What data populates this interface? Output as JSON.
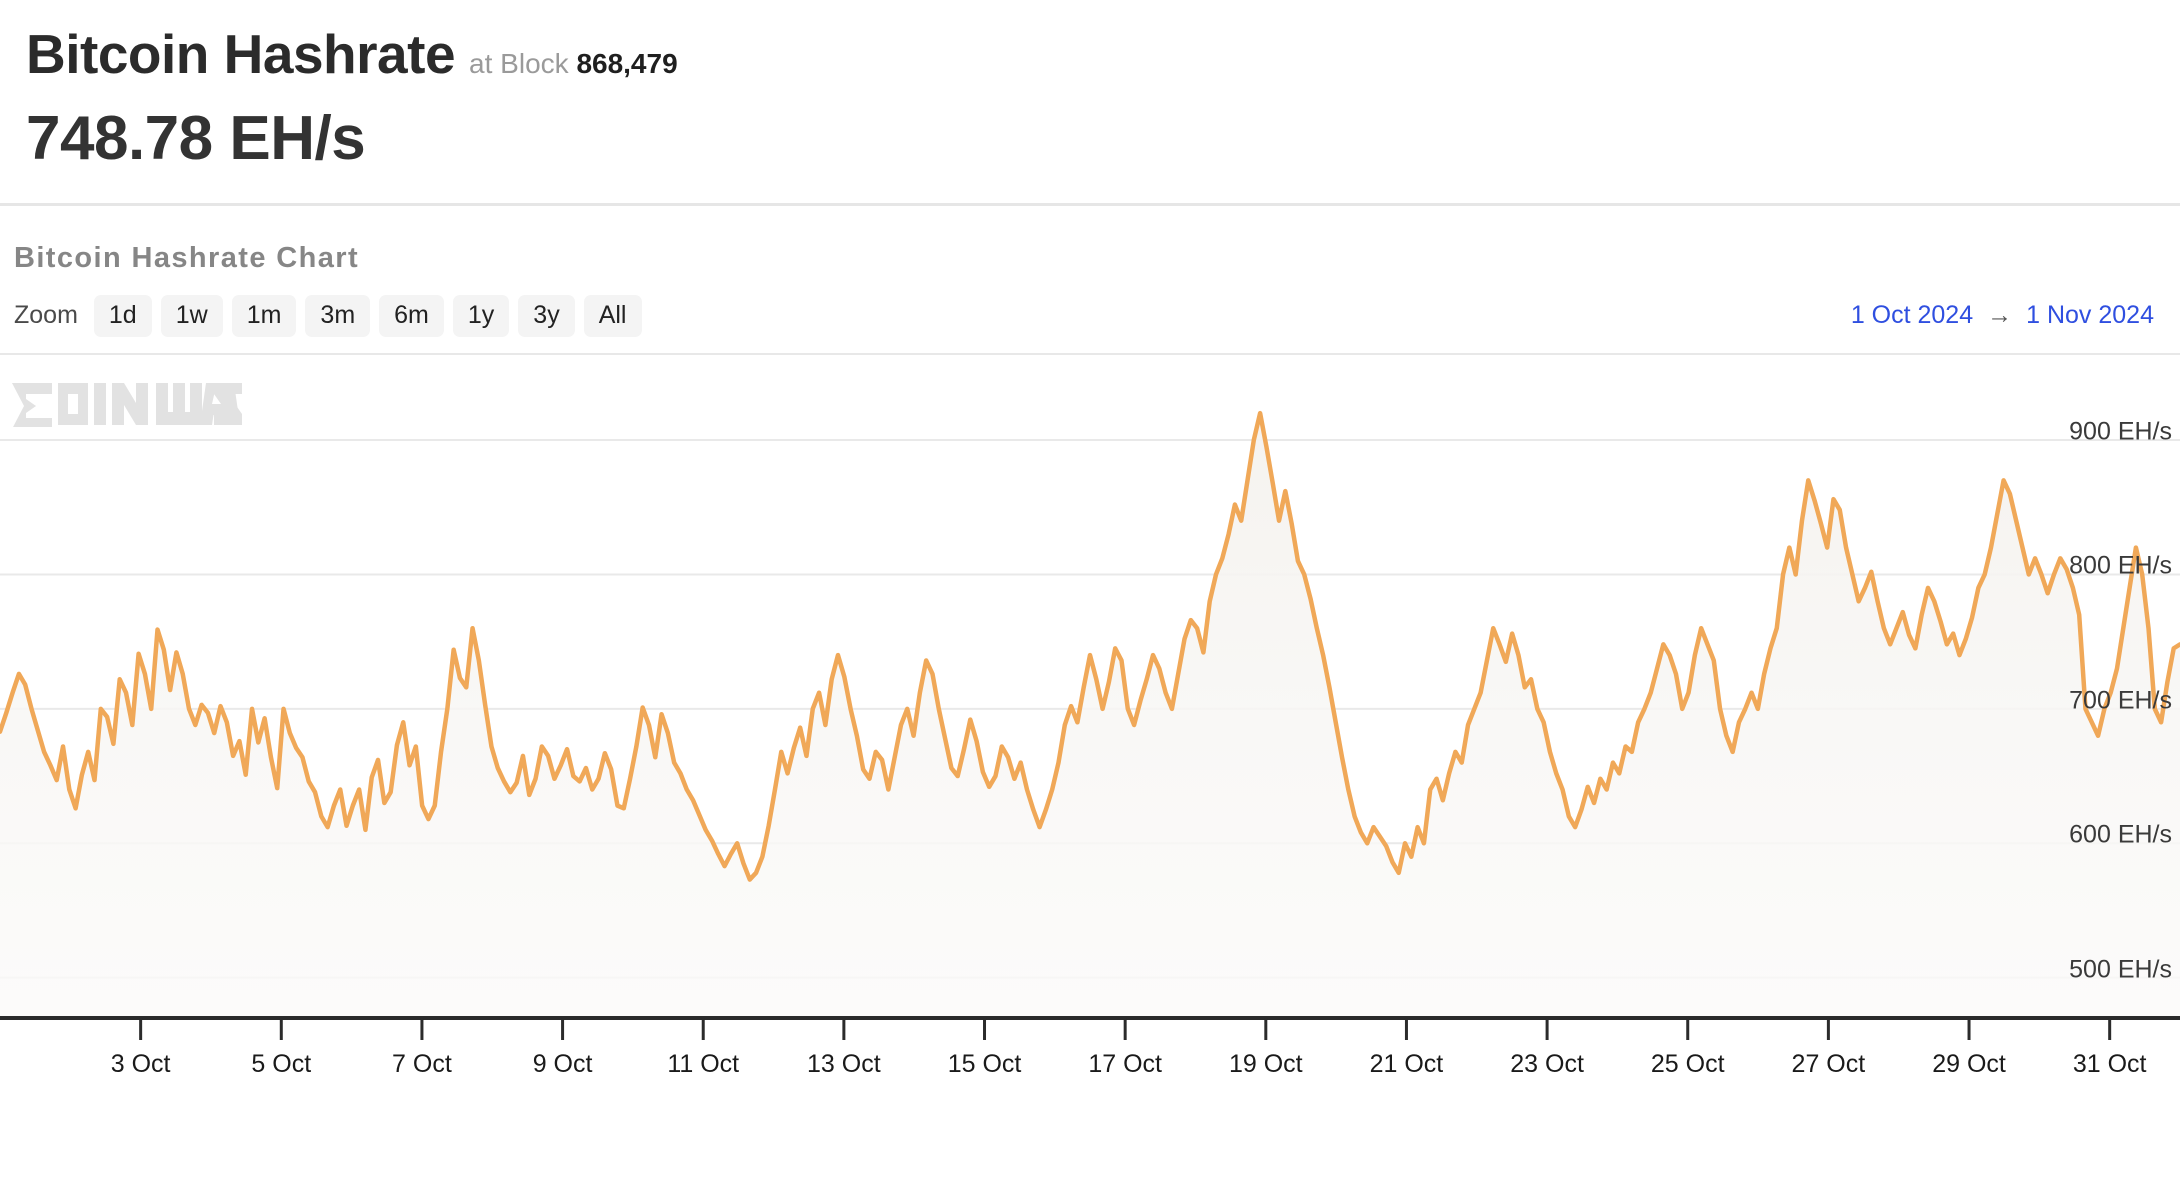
{
  "header": {
    "title": "Bitcoin Hashrate",
    "at_block_prefix": "at Block",
    "block_number": "868,479",
    "current_value": "748.78 EH/s"
  },
  "chart_section": {
    "title": "Bitcoin Hashrate Chart",
    "zoom_label": "Zoom",
    "zoom_buttons": [
      "1d",
      "1w",
      "1m",
      "3m",
      "6m",
      "1y",
      "3y",
      "All"
    ],
    "range_start": "1 Oct 2024",
    "range_arrow": "→",
    "range_end": "1 Nov 2024",
    "watermark": "CoinWarz",
    "accent_color": "#f0a858",
    "link_color": "#2f4fe0",
    "button_bg": "#f4f4f4"
  },
  "chart_data": {
    "type": "area",
    "title": "Bitcoin Hashrate Chart",
    "xlabel": "",
    "ylabel": "EH/s",
    "ylim": [
      470,
      935
    ],
    "yticks": [
      500,
      600,
      700,
      800,
      900
    ],
    "ytick_labels": [
      "500 EH/s",
      "600 EH/s",
      "700 EH/s",
      "800 EH/s",
      "900 EH/s"
    ],
    "xticks": [
      "3 Oct",
      "5 Oct",
      "7 Oct",
      "9 Oct",
      "11 Oct",
      "13 Oct",
      "15 Oct",
      "17 Oct",
      "19 Oct",
      "21 Oct",
      "23 Oct",
      "25 Oct",
      "27 Oct",
      "29 Oct",
      "31 Oct"
    ],
    "x_start": "1 Oct 2024",
    "x_end": "1 Nov 2024",
    "grid": "horizontal",
    "legend": "none",
    "series_name": "Bitcoin Hashrate",
    "line_color": "#f0a858",
    "fill_color": "#f7f5f2",
    "values": [
      683,
      697,
      712,
      726,
      718,
      700,
      684,
      668,
      658,
      647,
      672,
      640,
      626,
      651,
      668,
      647,
      700,
      694,
      674,
      722,
      712,
      688,
      741,
      726,
      700,
      759,
      744,
      714,
      742,
      726,
      700,
      688,
      703,
      697,
      682,
      702,
      690,
      665,
      676,
      651,
      700,
      675,
      693,
      664,
      641,
      700,
      682,
      671,
      664,
      646,
      638,
      620,
      612,
      628,
      640,
      613,
      628,
      640,
      610,
      649,
      662,
      630,
      638,
      673,
      690,
      658,
      672,
      628,
      618,
      628,
      668,
      700,
      744,
      723,
      716,
      760,
      736,
      703,
      672,
      656,
      646,
      638,
      645,
      665,
      636,
      648,
      672,
      665,
      648,
      658,
      670,
      650,
      646,
      656,
      640,
      648,
      667,
      655,
      628,
      626,
      648,
      672,
      701,
      688,
      664,
      696,
      682,
      660,
      652,
      640,
      632,
      621,
      610,
      602,
      592,
      583,
      592,
      600,
      585,
      573,
      578,
      590,
      613,
      640,
      668,
      652,
      671,
      686,
      665,
      700,
      712,
      688,
      722,
      740,
      724,
      700,
      680,
      655,
      648,
      668,
      662,
      640,
      664,
      688,
      700,
      680,
      712,
      736,
      726,
      700,
      678,
      656,
      650,
      670,
      692,
      676,
      653,
      642,
      650,
      672,
      664,
      648,
      660,
      640,
      625,
      612,
      625,
      640,
      660,
      688,
      702,
      690,
      716,
      740,
      722,
      700,
      720,
      745,
      736,
      700,
      688,
      706,
      722,
      740,
      730,
      712,
      700,
      726,
      752,
      766,
      760,
      742,
      780,
      800,
      812,
      830,
      852,
      840,
      870,
      900,
      920,
      895,
      868,
      840,
      862,
      838,
      810,
      800,
      782,
      760,
      740,
      716,
      690,
      664,
      640,
      620,
      608,
      600,
      612,
      605,
      598,
      586,
      578,
      600,
      590,
      612,
      600,
      640,
      648,
      632,
      652,
      668,
      660,
      688,
      700,
      712,
      736,
      760,
      748,
      735,
      756,
      740,
      716,
      722,
      700,
      690,
      668,
      652,
      640,
      620,
      612,
      625,
      642,
      630,
      648,
      640,
      660,
      652,
      672,
      668,
      690,
      700,
      712,
      730,
      748,
      740,
      726,
      700,
      712,
      740,
      760,
      748,
      736,
      700,
      680,
      668,
      690,
      700,
      712,
      700,
      726,
      745,
      760,
      800,
      820,
      800,
      840,
      870,
      855,
      838,
      820,
      856,
      848,
      820,
      800,
      780,
      790,
      802,
      780,
      760,
      748,
      760,
      772,
      755,
      745,
      770,
      790,
      780,
      765,
      748,
      756,
      740,
      752,
      768,
      790,
      800,
      820,
      845,
      870,
      860,
      840,
      820,
      800,
      812,
      800,
      786,
      800,
      812,
      804,
      790,
      770,
      700,
      690,
      680,
      700,
      712,
      730,
      760,
      790,
      820,
      800,
      760,
      700,
      690,
      720,
      745,
      748
    ]
  }
}
